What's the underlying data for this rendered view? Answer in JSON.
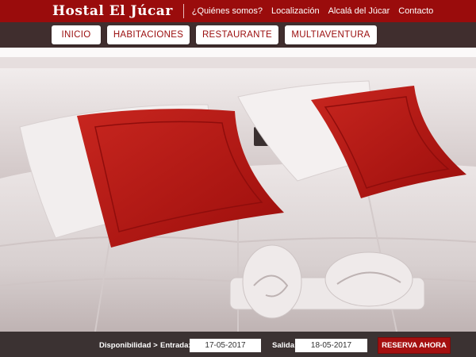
{
  "header": {
    "logo": "Hostal El Júcar",
    "links": [
      "¿Quiénes somos?",
      "Localización",
      "Alcalá del Júcar",
      "Contacto"
    ]
  },
  "nav": {
    "items": [
      "INICIO",
      "HABITACIONES",
      "RESTAURANTE",
      "MULTIAVENTURA"
    ]
  },
  "hero": {
    "image": "hotel bed with white bedding, red cushions and rolled towels"
  },
  "booking": {
    "availability_label": "Disponibilidad >",
    "checkin_label": "Entrada:",
    "checkin_value": "17-05-2017",
    "checkout_label": "Salida:",
    "checkout_value": "18-05-2017",
    "reserve_label": "RESERVA AHORA"
  },
  "colors": {
    "brand_red": "#9a0c0c",
    "booking_bar": "#3b3232",
    "cushion_red": "#b81414"
  }
}
